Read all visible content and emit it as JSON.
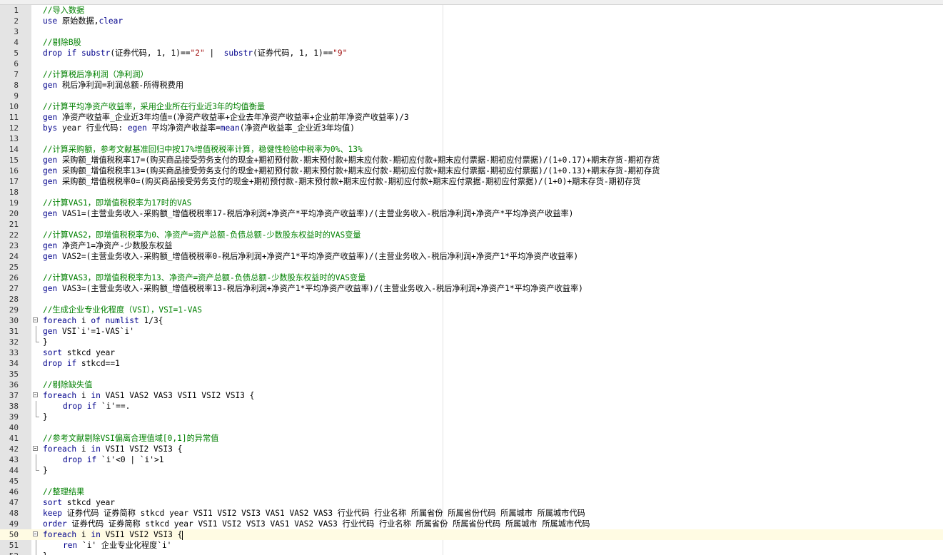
{
  "editor": {
    "current_line": 50,
    "lines": [
      {
        "n": "1",
        "text": "//导入数据",
        "type": "comment"
      },
      {
        "n": "2",
        "text": "use 原始数据,clear",
        "type": "code"
      },
      {
        "n": "3",
        "text": "",
        "type": "code"
      },
      {
        "n": "4",
        "text": "//剔除B股",
        "type": "comment"
      },
      {
        "n": "5",
        "text": "drop if substr(证券代码, 1, 1)==\"2\" |  substr(证券代码, 1, 1)==\"9\"",
        "type": "code"
      },
      {
        "n": "6",
        "text": "",
        "type": "code"
      },
      {
        "n": "7",
        "text": "//计算税后净利润（净利润）",
        "type": "comment"
      },
      {
        "n": "8",
        "text": "gen 税后净利润=利润总额-所得税费用",
        "type": "code"
      },
      {
        "n": "9",
        "text": "",
        "type": "code"
      },
      {
        "n": "10",
        "text": "//计算平均净资产收益率，采用企业所在行业近3年的均值衡量",
        "type": "comment"
      },
      {
        "n": "11",
        "text": "gen 净资产收益率_企业近3年均值=(净资产收益率+企业去年净资产收益率+企业前年净资产收益率)/3",
        "type": "code"
      },
      {
        "n": "12",
        "text": "bys year 行业代码: egen 平均净资产收益率=mean(净资产收益率_企业近3年均值)",
        "type": "code"
      },
      {
        "n": "13",
        "text": "",
        "type": "code"
      },
      {
        "n": "14",
        "text": "//计算采购额，参考文献基准回归中按17%增值税税率计算，稳健性检验中税率为0%、13%",
        "type": "comment"
      },
      {
        "n": "15",
        "text": "gen 采购额_增值税税率17=(购买商品接受劳务支付的现金+期初预付款-期末预付款+期末应付款-期初应付款+期末应付票据-期初应付票据)/(1+0.17)+期末存货-期初存货",
        "type": "code"
      },
      {
        "n": "16",
        "text": "gen 采购额_增值税税率13=(购买商品接受劳务支付的现金+期初预付款-期末预付款+期末应付款-期初应付款+期末应付票据-期初应付票据)/(1+0.13)+期末存货-期初存货",
        "type": "code"
      },
      {
        "n": "17",
        "text": "gen 采购额_增值税税率0=(购买商品接受劳务支付的现金+期初预付款-期末预付款+期末应付款-期初应付款+期末应付票据-期初应付票据)/(1+0)+期末存货-期初存货",
        "type": "code"
      },
      {
        "n": "18",
        "text": "",
        "type": "code"
      },
      {
        "n": "19",
        "text": "//计算VAS1，即增值税税率为17时的VAS",
        "type": "comment"
      },
      {
        "n": "20",
        "text": "gen VAS1=(主营业务收入-采购额_增值税税率17-税后净利润+净资产*平均净资产收益率)/(主营业务收入-税后净利润+净资产*平均净资产收益率)",
        "type": "code"
      },
      {
        "n": "21",
        "text": "",
        "type": "code"
      },
      {
        "n": "22",
        "text": "//计算VAS2，即增值税税率为0、净资产=资产总额-负债总额-少数股东权益时的VAS变量",
        "type": "comment"
      },
      {
        "n": "23",
        "text": "gen 净资产1=净资产-少数股东权益",
        "type": "code"
      },
      {
        "n": "24",
        "text": "gen VAS2=(主营业务收入-采购额_增值税税率0-税后净利润+净资产1*平均净资产收益率)/(主营业务收入-税后净利润+净资产1*平均净资产收益率)",
        "type": "code"
      },
      {
        "n": "25",
        "text": "",
        "type": "code"
      },
      {
        "n": "26",
        "text": "//计算VAS3，即增值税税率为13、净资产=资产总额-负债总额-少数股东权益时的VAS变量",
        "type": "comment"
      },
      {
        "n": "27",
        "text": "gen VAS3=(主营业务收入-采购额_增值税税率13-税后净利润+净资产1*平均净资产收益率)/(主营业务收入-税后净利润+净资产1*平均净资产收益率)",
        "type": "code"
      },
      {
        "n": "28",
        "text": "",
        "type": "code"
      },
      {
        "n": "29",
        "text": "//生成企业专业化程度（VSI），VSI=1-VAS",
        "type": "comment"
      },
      {
        "n": "30",
        "text": "foreach i of numlist 1/3{",
        "type": "code",
        "fold": "open"
      },
      {
        "n": "31",
        "text": "gen VSI`i'=1-VAS`i'",
        "type": "code",
        "fold": "line"
      },
      {
        "n": "32",
        "text": "}",
        "type": "code",
        "fold": "end"
      },
      {
        "n": "33",
        "text": "sort stkcd year",
        "type": "code"
      },
      {
        "n": "34",
        "text": "drop if stkcd==1",
        "type": "code"
      },
      {
        "n": "35",
        "text": "",
        "type": "code"
      },
      {
        "n": "36",
        "text": "//剔除缺失值",
        "type": "comment"
      },
      {
        "n": "37",
        "text": "foreach i in VAS1 VAS2 VAS3 VSI1 VSI2 VSI3 {",
        "type": "code",
        "fold": "open"
      },
      {
        "n": "38",
        "text": "drop if `i'==.",
        "type": "code",
        "fold": "line",
        "indent": 1
      },
      {
        "n": "39",
        "text": "}",
        "type": "code",
        "fold": "end"
      },
      {
        "n": "40",
        "text": "",
        "type": "code"
      },
      {
        "n": "41",
        "text": "//参考文献剔除VSI偏离合理值域[0,1]的异常值",
        "type": "comment"
      },
      {
        "n": "42",
        "text": "foreach i in VSI1 VSI2 VSI3 {",
        "type": "code",
        "fold": "open"
      },
      {
        "n": "43",
        "text": "drop if `i'<0 | `i'>1",
        "type": "code",
        "fold": "line",
        "indent": 1
      },
      {
        "n": "44",
        "text": "}",
        "type": "code",
        "fold": "end"
      },
      {
        "n": "45",
        "text": "",
        "type": "code"
      },
      {
        "n": "46",
        "text": "//整理结果",
        "type": "comment"
      },
      {
        "n": "47",
        "text": "sort stkcd year",
        "type": "code"
      },
      {
        "n": "48",
        "text": "keep 证券代码 证券简称 stkcd year VSI1 VSI2 VSI3 VAS1 VAS2 VAS3 行业代码 行业名称 所属省份 所属省份代码 所属城市 所属城市代码",
        "type": "code"
      },
      {
        "n": "49",
        "text": "order 证券代码 证券简称 stkcd year VSI1 VSI2 VSI3 VAS1 VAS2 VAS3 行业代码 行业名称 所属省份 所属省份代码 所属城市 所属城市代码",
        "type": "code"
      },
      {
        "n": "50",
        "text": "foreach i in VSI1 VSI2 VSI3 {",
        "type": "code",
        "fold": "open"
      },
      {
        "n": "51",
        "text": "ren `i' 企业专业化程度`i'",
        "type": "code",
        "fold": "line",
        "indent": 1
      },
      {
        "n": "52",
        "text": "}",
        "type": "code",
        "fold": "end"
      }
    ]
  }
}
